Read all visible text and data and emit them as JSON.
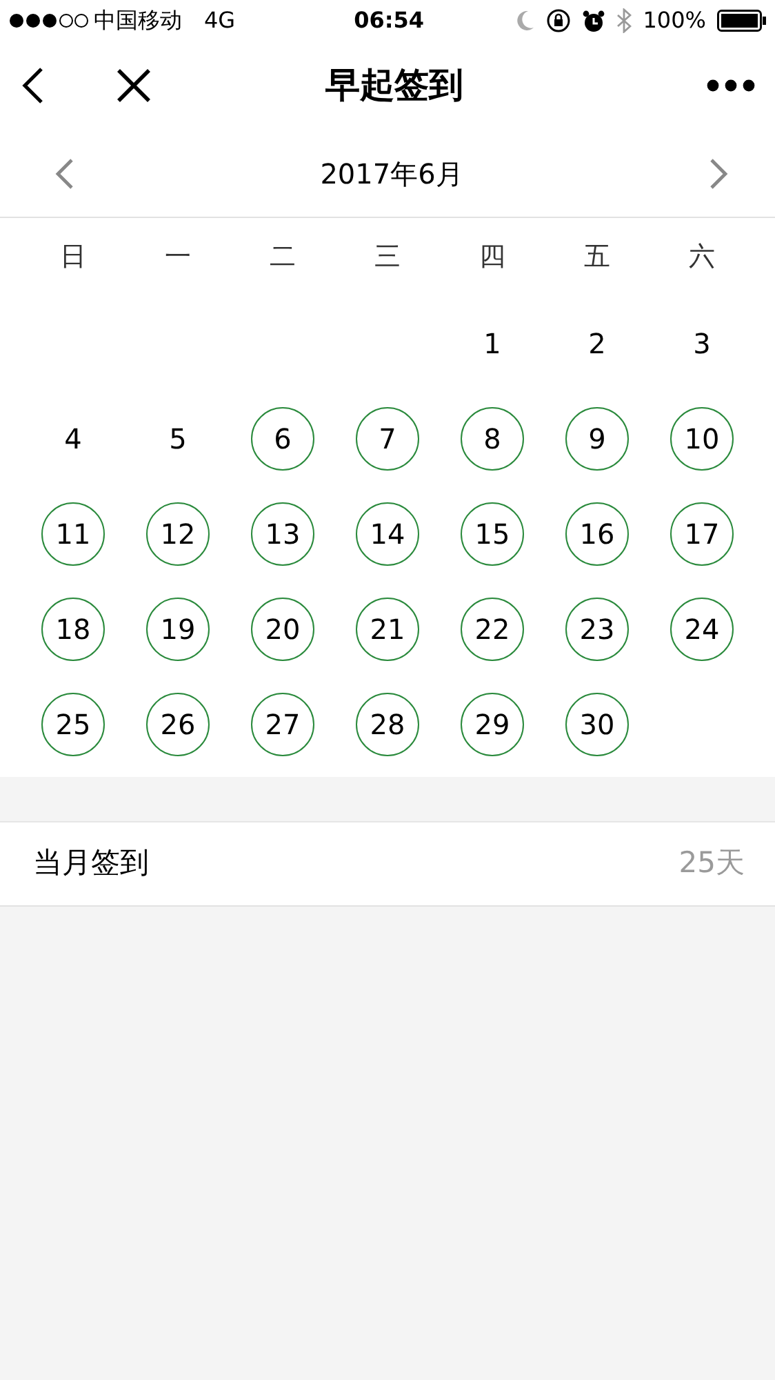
{
  "status_bar": {
    "carrier": "中国移动",
    "network": "4G",
    "time": "06:54",
    "battery": "100%"
  },
  "nav": {
    "title": "早起签到"
  },
  "calendar": {
    "month": "2017年6月",
    "weekdays": [
      "日",
      "一",
      "二",
      "三",
      "四",
      "五",
      "六"
    ],
    "weeks": [
      {
        "days": [
          {
            "kind": "blank"
          },
          {
            "kind": "blank"
          },
          {
            "kind": "blank"
          },
          {
            "kind": "blank"
          },
          {
            "kind": "date",
            "day": "1",
            "checked": false
          },
          {
            "kind": "date",
            "day": "2",
            "checked": false
          },
          {
            "kind": "date",
            "day": "3",
            "checked": false
          }
        ]
      },
      {
        "days": [
          {
            "kind": "date",
            "day": "4",
            "checked": false
          },
          {
            "kind": "date",
            "day": "5",
            "checked": false
          },
          {
            "kind": "date",
            "day": "6",
            "checked": true
          },
          {
            "kind": "date",
            "day": "7",
            "checked": true
          },
          {
            "kind": "date",
            "day": "8",
            "checked": true
          },
          {
            "kind": "date",
            "day": "9",
            "checked": true
          },
          {
            "kind": "date",
            "day": "10",
            "checked": true
          }
        ]
      },
      {
        "days": [
          {
            "kind": "date",
            "day": "11",
            "checked": true
          },
          {
            "kind": "date",
            "day": "12",
            "checked": true
          },
          {
            "kind": "date",
            "day": "13",
            "checked": true
          },
          {
            "kind": "date",
            "day": "14",
            "checked": true
          },
          {
            "kind": "date",
            "day": "15",
            "checked": true
          },
          {
            "kind": "date",
            "day": "16",
            "checked": true
          },
          {
            "kind": "date",
            "day": "17",
            "checked": true
          }
        ]
      },
      {
        "days": [
          {
            "kind": "date",
            "day": "18",
            "checked": true
          },
          {
            "kind": "date",
            "day": "19",
            "checked": true
          },
          {
            "kind": "date",
            "day": "20",
            "checked": true
          },
          {
            "kind": "date",
            "day": "21",
            "checked": true
          },
          {
            "kind": "date",
            "day": "22",
            "checked": true
          },
          {
            "kind": "date",
            "day": "23",
            "checked": true
          },
          {
            "kind": "date",
            "day": "24",
            "checked": true
          }
        ]
      },
      {
        "days": [
          {
            "kind": "date",
            "day": "25",
            "checked": true
          },
          {
            "kind": "date",
            "day": "26",
            "checked": true
          },
          {
            "kind": "date",
            "day": "27",
            "checked": true
          },
          {
            "kind": "date",
            "day": "28",
            "checked": true
          },
          {
            "kind": "date",
            "day": "29",
            "checked": true
          },
          {
            "kind": "date",
            "day": "30",
            "checked": true
          }
        ]
      }
    ]
  },
  "summary": {
    "label": "当月签到",
    "value": "25天"
  }
}
